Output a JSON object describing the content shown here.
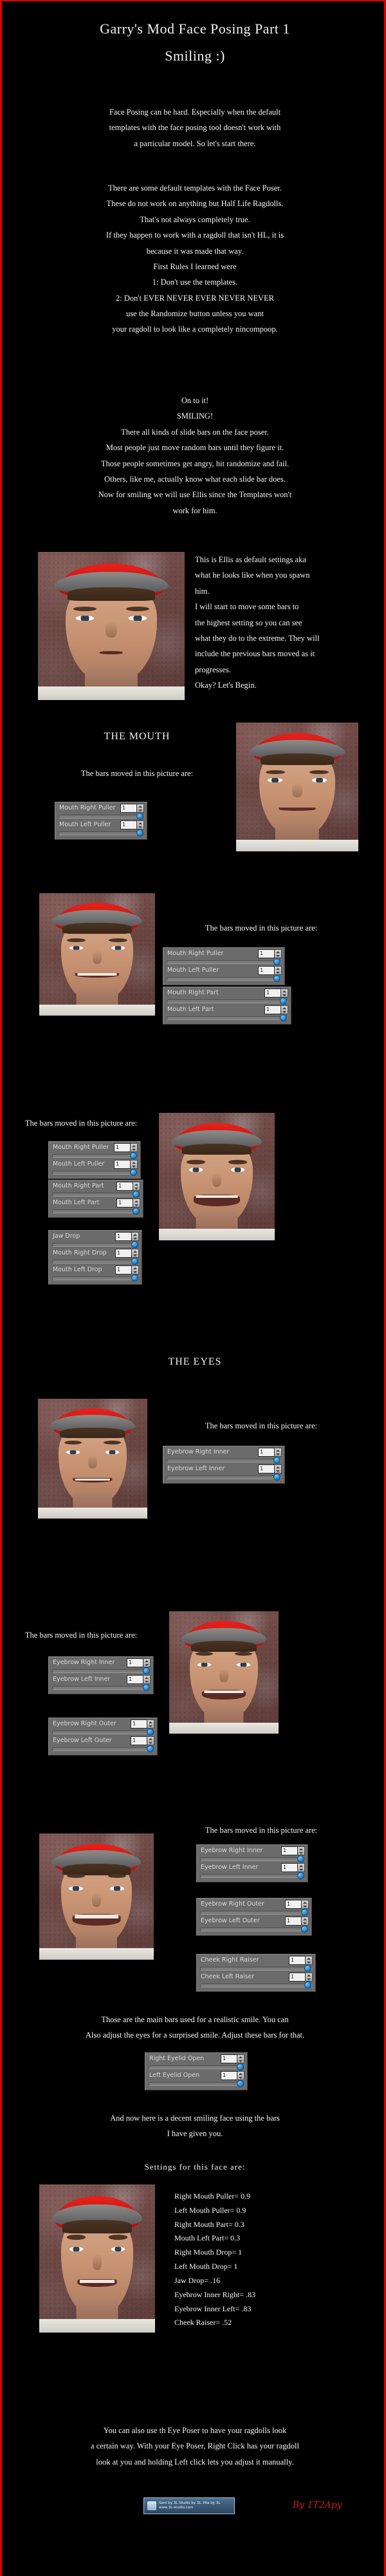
{
  "page": {
    "title_line1": "Garry's Mod Face Posing Part 1",
    "title_line2": "Smiling :)",
    "border_color": "#e00000",
    "background_color": "#000000",
    "text_color": "#ffffff"
  },
  "intro": {
    "para1": [
      "Face Posing can be hard. Especially when the default",
      "templates with the face posing tool doesn't work with",
      "a particular model. So let's start there."
    ],
    "para2": [
      "There are some default templates with the Face Poser.",
      "These do not work on anything but Half Life Ragdolls.",
      "That's not always completely true.",
      "If they happen to work with a ragdoll that isn't HL, it is",
      "because it was made that way.",
      "First Rules I learned were",
      "1: Don't use the templates.",
      "2: Don't EVER NEVER EVER NEVER NEVER",
      "use the Randomize button unless you want",
      "your ragdoll to look like a completely nincompoop."
    ],
    "para3": [
      "On to it!",
      "SMILING!",
      "There all kinds of slide bars on the face poser.",
      "Most people just move random bars until they figure it.",
      "Those people sometimes get angry, hit randomize and fail.",
      "Others, like me, actually know what each slide bar does.",
      "Now for smiling we will use Ellis since the Templates won't",
      "work for him."
    ]
  },
  "default_shot": {
    "caption": [
      "This is Ellis as default settings aka",
      "what he looks like when you spawn",
      "him.",
      "I will start to move some bars to",
      "the highest setting so you can see",
      "what they do to the extreme. They will",
      "include the previous bars moved as it",
      "progresses.",
      "Okay? Let's Begin."
    ]
  },
  "sections": {
    "mouth_heading": "THE MOUTH",
    "eyes_heading": "THE EYES",
    "bars_moved_label": "The bars moved in this picture are:"
  },
  "slider_groups": [
    {
      "id": "mouth-step-1",
      "groups": [
        {
          "sliders": [
            {
              "label": "Mouth Right Puller",
              "value": "1"
            },
            {
              "label": "Mouth Left Puller",
              "value": "1"
            }
          ]
        }
      ]
    },
    {
      "id": "mouth-step-2",
      "groups": [
        {
          "sliders": [
            {
              "label": "Mouth Right Puller",
              "value": "1"
            },
            {
              "label": "Mouth Left Puller",
              "value": "1"
            }
          ]
        },
        {
          "sliders": [
            {
              "label": "Mouth Right Part",
              "value": "1"
            },
            {
              "label": "Mouth Left Part",
              "value": "1"
            }
          ]
        }
      ]
    },
    {
      "id": "mouth-step-3",
      "groups": [
        {
          "sliders": [
            {
              "label": "Mouth Right Puller",
              "value": "1"
            },
            {
              "label": "Mouth Left Puller",
              "value": "1"
            }
          ]
        },
        {
          "sliders": [
            {
              "label": "Mouth Right Part",
              "value": "1"
            },
            {
              "label": "Mouth Left Part",
              "value": "1"
            }
          ]
        },
        {
          "sliders": [
            {
              "label": "Jaw Drop",
              "value": "1"
            },
            {
              "label": "Mouth Right Drop",
              "value": "1"
            },
            {
              "label": "Mouth Left Drop",
              "value": "1"
            }
          ]
        }
      ]
    },
    {
      "id": "eyes-step-1",
      "groups": [
        {
          "sliders": [
            {
              "label": "Eyebrow Right Inner",
              "value": "1"
            },
            {
              "label": "Eyebrow Left Inner",
              "value": "1"
            }
          ]
        }
      ]
    },
    {
      "id": "eyes-step-2",
      "groups": [
        {
          "sliders": [
            {
              "label": "Eyebrow Right Inner",
              "value": "1"
            },
            {
              "label": "Eyebrow Left Inner",
              "value": "1"
            }
          ]
        },
        {
          "sliders": [
            {
              "label": "Eyebrow Right Outer",
              "value": "1"
            },
            {
              "label": "Eyebrow Left Outer",
              "value": "1"
            }
          ]
        }
      ]
    },
    {
      "id": "eyes-step-3",
      "groups": [
        {
          "sliders": [
            {
              "label": "Eyebrow Right Inner",
              "value": "1"
            },
            {
              "label": "Eyebrow Left Inner",
              "value": "1"
            }
          ]
        },
        {
          "sliders": [
            {
              "label": "Eyebrow Right Outer",
              "value": "1"
            },
            {
              "label": "Eyebrow Left Outer",
              "value": "1"
            }
          ]
        },
        {
          "sliders": [
            {
              "label": "Cheek Right Raiser",
              "value": "1"
            },
            {
              "label": "Cheek Left Raiser",
              "value": "1"
            }
          ]
        }
      ]
    },
    {
      "id": "eyelids",
      "groups": [
        {
          "sliders": [
            {
              "label": "Right Eyelid Open",
              "value": "1"
            },
            {
              "label": "Left Eyelid Open",
              "value": "1"
            }
          ]
        }
      ]
    }
  ],
  "closing": {
    "realistic": [
      "Those are the main bars used for a realistic smile. You can",
      "Also adjust the eyes for a surprised smile. Adjust these bars for that."
    ],
    "decent": [
      "And now here is a decent smiling face using the bars",
      "I have given you."
    ],
    "settings_heading": "Settings for this face are:",
    "settings": [
      "Right Mouth Puller= 0.9",
      "Left Mouth Puller= 0.9",
      "Right Mouth Part= 0.3",
      "Mouth Left Part= 0.3",
      "Right Mouth Drop= 1",
      "Left Mouth Drop= 1",
      "Jaw Drop= .16",
      "Eyebrow Inner Right= .83",
      "Eyebrow Inner Left= .83",
      "Cheek Raiser= .52"
    ],
    "eye_poser": [
      "You can also use th Eye Poser to have your ragdolls look",
      "a certain way. With your Eye Poser, Right Click has your ragdoll",
      "look at you and holding Left click lets you adjust it manually."
    ]
  },
  "footer": {
    "banner_text_line1": "Sent by 3L Studio by 3L. Mia by 3L",
    "banner_text_line2": "www.3L-studio.com",
    "signature": "By 1T2Apy"
  }
}
